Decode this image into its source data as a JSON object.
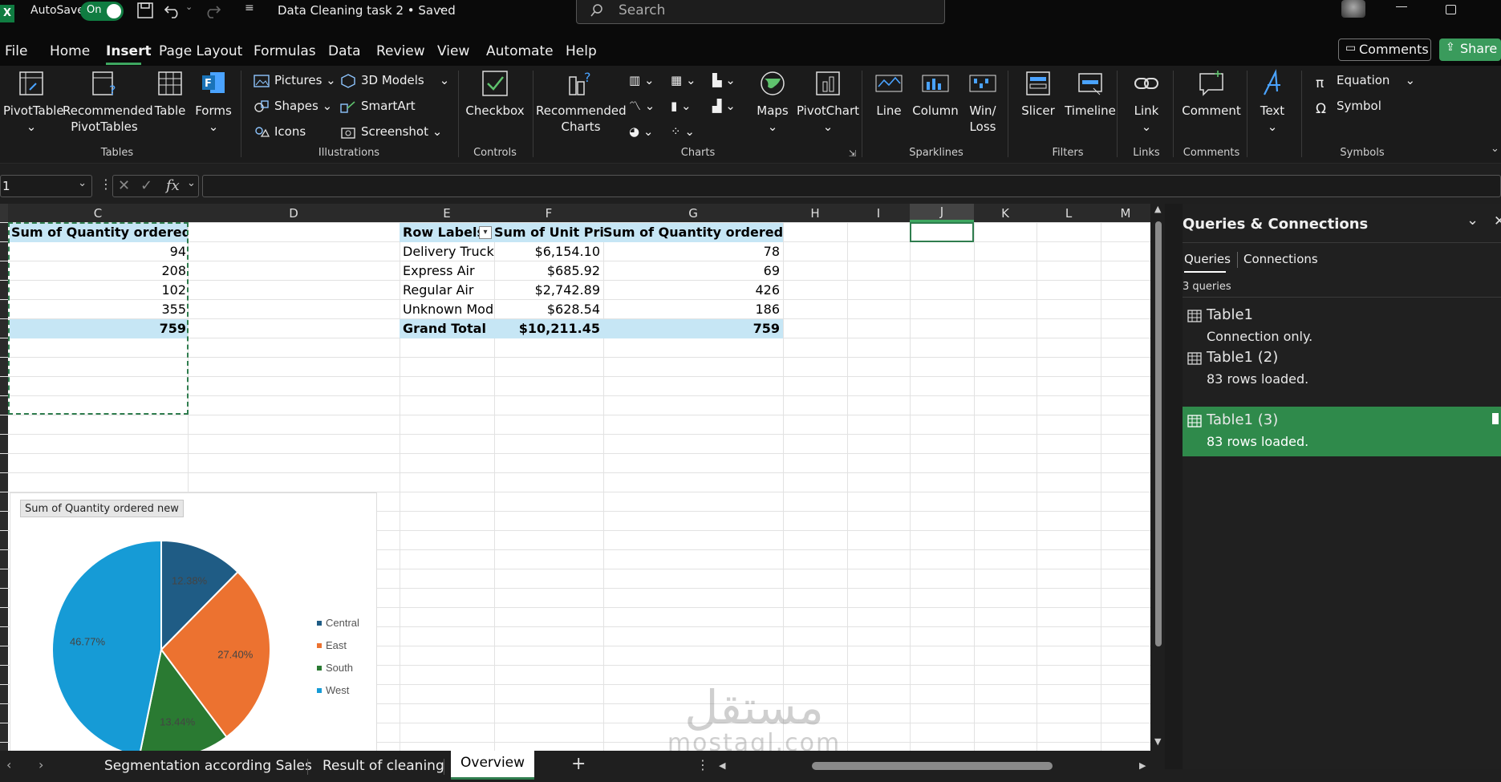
{
  "titlebar": {
    "autosave_label": "AutoSave",
    "autosave_state": "On",
    "doc_title": "Data Cleaning task 2 • Saved",
    "search_placeholder": "Search",
    "app_letter": "X"
  },
  "menu": {
    "items": [
      "File",
      "Home",
      "Insert",
      "Page Layout",
      "Formulas",
      "Data",
      "Review",
      "View",
      "Automate",
      "Help"
    ],
    "active": "Insert",
    "comments": "Comments",
    "share": "Share"
  },
  "ribbon": {
    "tables": {
      "group": "Tables",
      "pivottable": "PivotTable",
      "recommended1": "Recommended",
      "recommended2": "PivotTables",
      "table": "Table",
      "forms": "Forms"
    },
    "illustrations": {
      "group": "Illustrations",
      "pictures": "Pictures",
      "shapes": "Shapes",
      "icons": "Icons",
      "models": "3D Models",
      "smartart": "SmartArt",
      "screenshot": "Screenshot"
    },
    "controls": {
      "group": "Controls",
      "checkbox": "Checkbox"
    },
    "charts": {
      "group": "Charts",
      "rec1": "Recommended",
      "rec2": "Charts",
      "maps": "Maps",
      "pivotchart": "PivotChart"
    },
    "sparklines": {
      "group": "Sparklines",
      "line": "Line",
      "column": "Column",
      "winloss1": "Win/",
      "winloss2": "Loss"
    },
    "filters": {
      "group": "Filters",
      "slicer": "Slicer",
      "timeline": "Timeline"
    },
    "links": {
      "group": "Links",
      "link": "Link"
    },
    "comments": {
      "group": "Comments",
      "comment": "Comment"
    },
    "text": {
      "text": "Text"
    },
    "symbols": {
      "group": "Symbols",
      "equation": "Equation",
      "symbol": "Symbol"
    }
  },
  "formula": {
    "namebox": "1",
    "fx": "fx"
  },
  "columns": [
    "C",
    "D",
    "E",
    "F",
    "G",
    "H",
    "I",
    "J",
    "K",
    "L",
    "M"
  ],
  "left_pivot": {
    "header": "Sum of Quantity ordered new",
    "values": [
      "94",
      "208",
      "102",
      "355"
    ],
    "total": "759"
  },
  "pivot": {
    "headers": [
      "Row Labels",
      "Sum of Unit Price",
      "Sum of Quantity ordered new"
    ],
    "rows": [
      [
        "Delivery Truck",
        "$6,154.10",
        "78"
      ],
      [
        "Express Air",
        "$685.92",
        "69"
      ],
      [
        "Regular Air",
        "$2,742.89",
        "426"
      ],
      [
        "Unknown Mode",
        "$628.54",
        "186"
      ]
    ],
    "total": [
      "Grand Total",
      "$10,211.45",
      "759"
    ]
  },
  "chart_data": {
    "type": "pie",
    "title": "Sum of Quantity ordered new",
    "categories": [
      "Central",
      "East",
      "South",
      "West"
    ],
    "values": [
      12.38,
      27.4,
      13.44,
      46.77
    ],
    "labels": [
      "12.38%",
      "27.40%",
      "13.44%",
      "46.77%"
    ],
    "colors": [
      "#1f5c85",
      "#ec7230",
      "#2a7a32",
      "#169bd6"
    ],
    "legend": "right"
  },
  "queries": {
    "title": "Queries & Connections",
    "tab_queries": "Queries",
    "tab_connections": "Connections",
    "count": "3 queries",
    "items": [
      {
        "name": "Table1",
        "status": "Connection only."
      },
      {
        "name": "Table1 (2)",
        "status": "83 rows loaded."
      },
      {
        "name": "Table1 (3)",
        "status": "83 rows loaded."
      }
    ]
  },
  "sheets": [
    "Segmentation according Sales",
    "Result of cleaning",
    "Overview"
  ],
  "watermark": {
    "arabic": "مستقل",
    "latin": "mostaql.com"
  }
}
